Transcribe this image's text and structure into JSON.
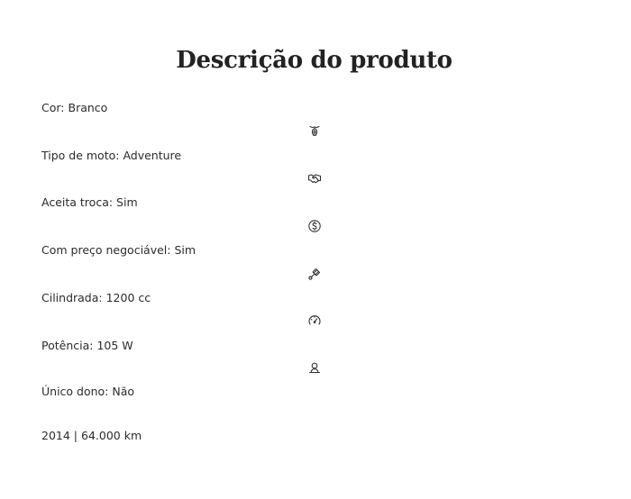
{
  "page": {
    "title": "Descrição do produto"
  },
  "specs": [
    {
      "label": "Cor:",
      "value": "Branco"
    },
    {
      "label": "Tipo de moto:",
      "value": "Adventure"
    },
    {
      "label": "Aceita troca:",
      "value": "Sim"
    },
    {
      "label": "Com preço negociável:",
      "value": "Sim"
    },
    {
      "label": "Cilindrada:",
      "value": "1200 cc"
    },
    {
      "label": "Potência:",
      "value": "105 W"
    },
    {
      "label": "Único dono:",
      "value": "Não"
    }
  ],
  "summary": {
    "year": "2014",
    "separator": "|",
    "mileage": "64.000 km"
  },
  "icons": [
    "motorcycle-icon",
    "handshake-icon",
    "dollar-coin-icon",
    "piston-icon",
    "speedometer-icon",
    "owner-icon"
  ]
}
